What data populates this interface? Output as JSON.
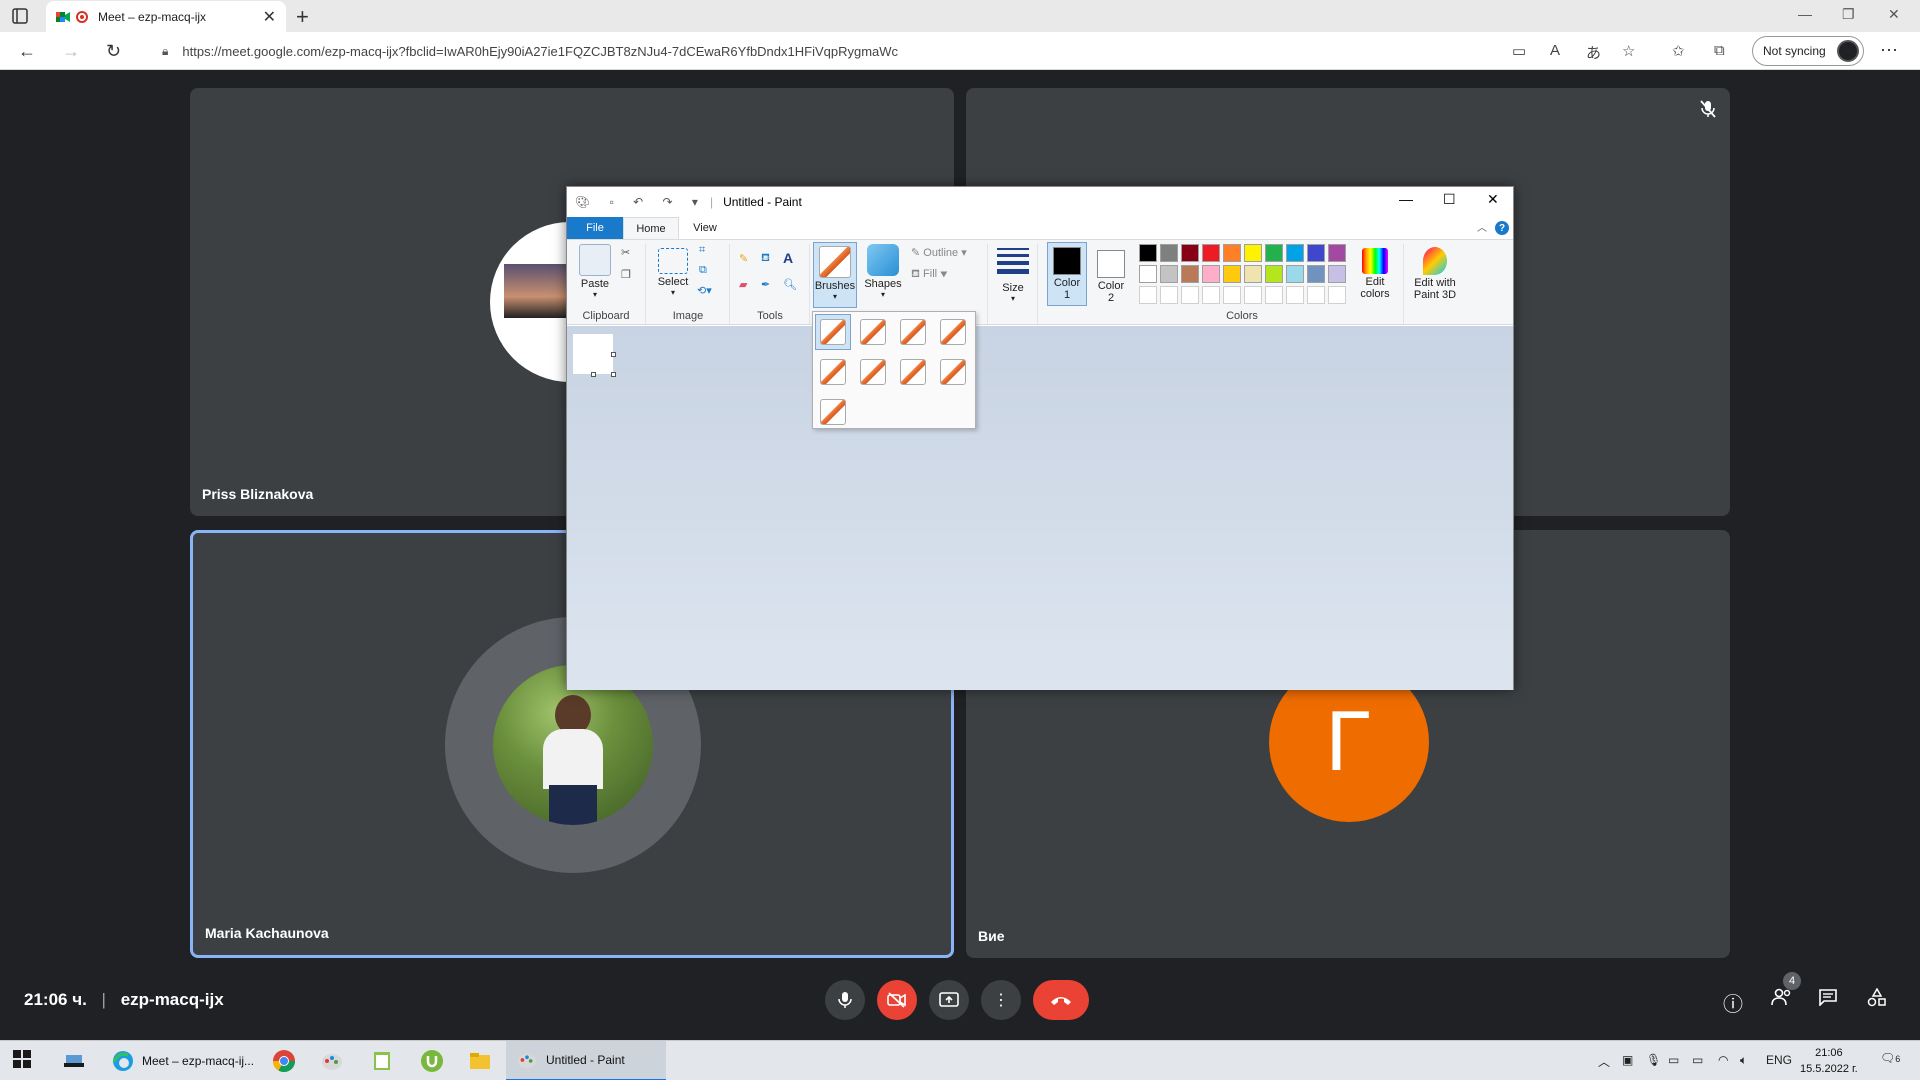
{
  "browser": {
    "tab_title": "Meet – ezp-macq-ijx",
    "url": "https://meet.google.com/ezp-macq-ijx?fbclid=IwAR0hEjy90iA27ie1FQZCJBT8zNJu4-7dCEwaR6YfbDndx1HFiVqpRygmaWc",
    "sync_label": "Not syncing"
  },
  "meet": {
    "tiles": [
      {
        "name": "Priss Bliznakova"
      },
      {
        "name": ""
      },
      {
        "name": "Maria Kachaunova"
      },
      {
        "name": "Вие",
        "avatar_letter": "Г"
      }
    ],
    "time": "21:06 ч.",
    "meeting_code": "ezp-macq-ijx",
    "participants_count": "4"
  },
  "paint": {
    "title": "Untitled - Paint",
    "tabs": {
      "file": "File",
      "home": "Home",
      "view": "View"
    },
    "ribbon": {
      "paste": "Paste",
      "clipboard": "Clipboard",
      "select": "Select",
      "image": "Image",
      "tools": "Tools",
      "brushes": "Brushes",
      "shapes": "Shapes",
      "outline": "Outline",
      "fill": "Fill",
      "size": "Size",
      "color1": "Color 1",
      "color2": "Color 2",
      "colors": "Colors",
      "edit_colors": "Edit colors",
      "edit_paint3d": "Edit with Paint 3D"
    },
    "palette_row1": [
      "#000000",
      "#7f7f7f",
      "#880015",
      "#ed1c24",
      "#ff7f27",
      "#fff200",
      "#22b14c",
      "#00a2e8",
      "#3f48cc",
      "#a349a4"
    ],
    "palette_row2": [
      "#ffffff",
      "#c3c3c3",
      "#b97a57",
      "#ffaec9",
      "#ffc90e",
      "#efe4b0",
      "#b5e61d",
      "#99d9ea",
      "#7092be",
      "#c8bfe7"
    ],
    "color1_value": "#000000",
    "color2_value": "#ffffff"
  },
  "taskbar": {
    "apps": [
      {
        "label": "Meet – ezp-macq-ij..."
      },
      {
        "label": "Untitled - Paint"
      }
    ],
    "language": "ENG",
    "time": "21:06",
    "date": "15.5.2022 г.",
    "notifications": "6"
  }
}
